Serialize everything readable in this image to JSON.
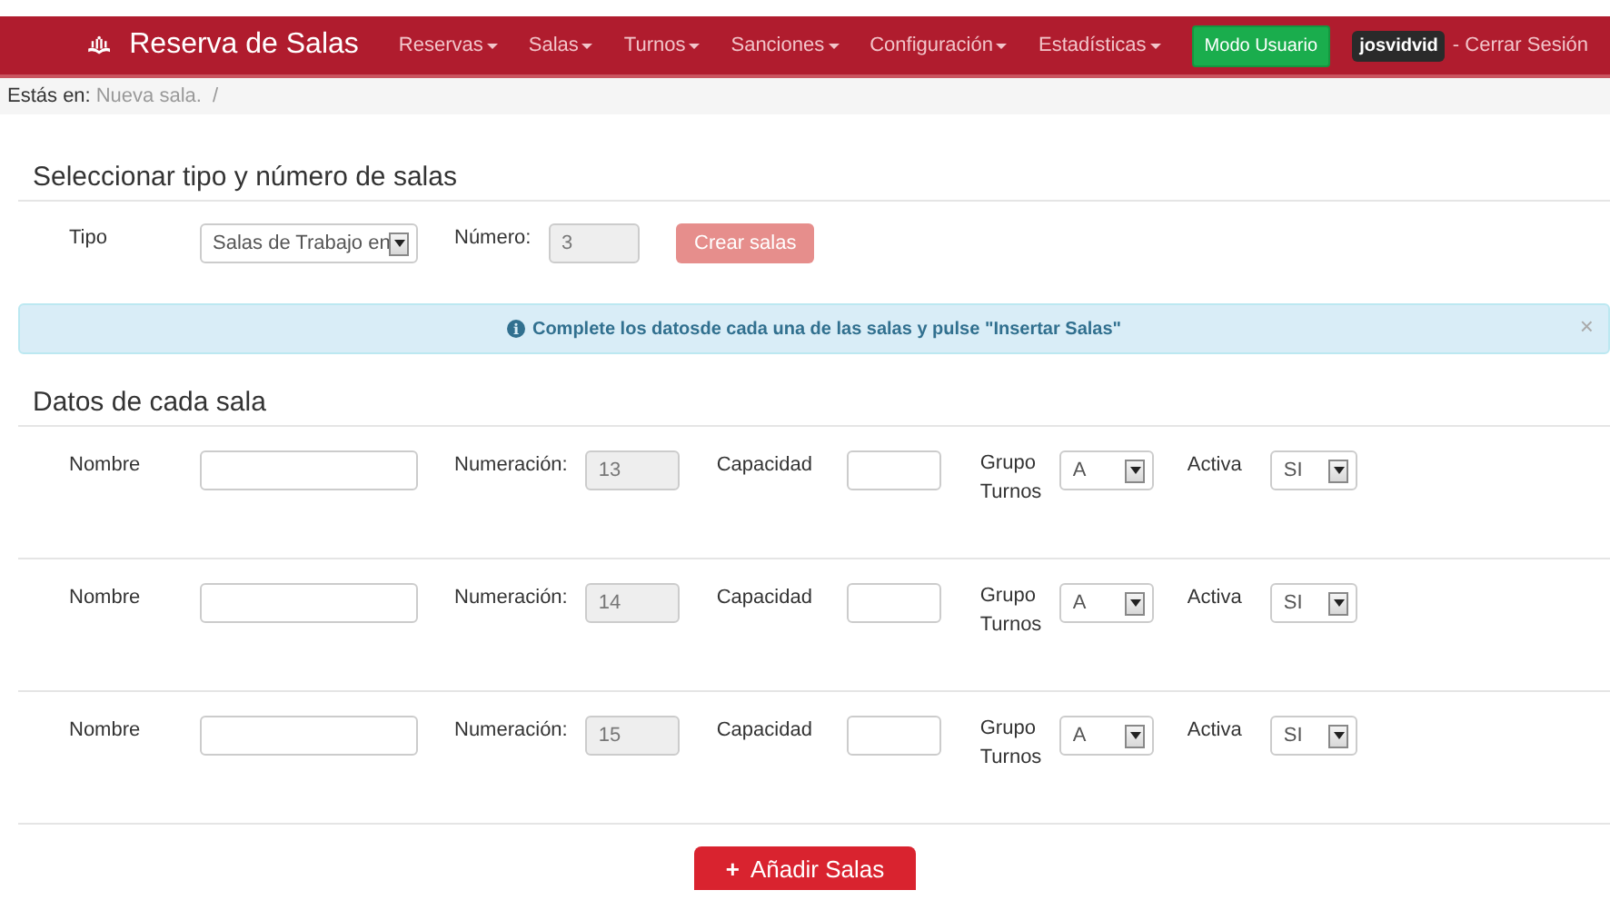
{
  "navbar": {
    "brand": "Reserva de Salas",
    "menus": [
      {
        "label": "Reservas"
      },
      {
        "label": "Salas"
      },
      {
        "label": "Turnos"
      },
      {
        "label": "Sanciones"
      },
      {
        "label": "Configuración"
      },
      {
        "label": "Estadísticas"
      }
    ],
    "mode_button": "Modo Usuario",
    "user": "josvidvid",
    "logout": "- Cerrar Sesión"
  },
  "breadcrumb": {
    "label": "Estás en:",
    "current": "Nueva sala.",
    "separator": "/"
  },
  "select_section": {
    "title": "Seleccionar tipo y número de salas",
    "type_label": "Tipo",
    "type_value": "Salas de Trabajo en",
    "number_label": "Número:",
    "number_value": "3",
    "create_button": {
      "label": "Crear salas",
      "disabled": true
    }
  },
  "alert": {
    "icon": "i",
    "message": "Complete los datosde cada una de las salas y pulse \"Insertar Salas\"",
    "close": "×"
  },
  "rooms_section": {
    "title": "Datos de cada sala",
    "rooms": [
      {
        "name_label": "Nombre",
        "numbering_label": "Numeración:",
        "numbering": "13",
        "capacity_label": "Capacidad",
        "group_label": "Grupo Turnos",
        "group": "A",
        "active_label": "Activa",
        "active": "SI"
      },
      {
        "name_label": "Nombre",
        "numbering_label": "Numeración:",
        "numbering": "14",
        "capacity_label": "Capacidad",
        "group_label": "Grupo Turnos",
        "group": "A",
        "active_label": "Activa",
        "active": "SI"
      },
      {
        "name_label": "Nombre",
        "numbering_label": "Numeración:",
        "numbering": "15",
        "capacity_label": "Capacidad",
        "group_label": "Grupo Turnos",
        "group": "A",
        "active_label": "Activa",
        "active": "SI"
      }
    ]
  },
  "add_button": {
    "icon": "+",
    "label": "Añadir Salas"
  }
}
